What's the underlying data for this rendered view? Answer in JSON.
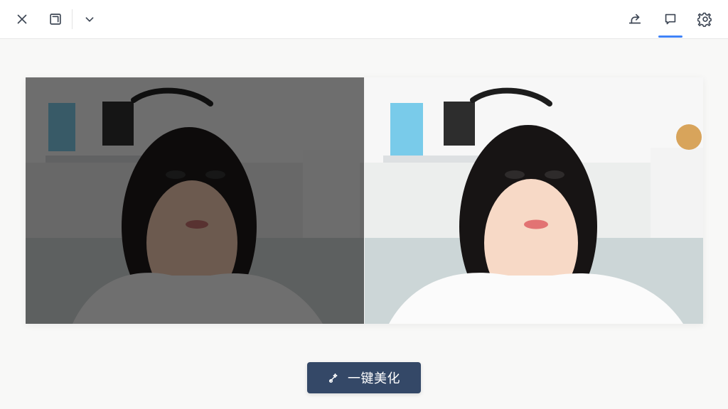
{
  "toolbar": {
    "left_icons": [
      "close-icon",
      "window-restore-icon",
      "chevron-down-icon"
    ],
    "right_icons": [
      "share-icon",
      "compare-view-icon",
      "settings-icon"
    ],
    "active_icon": "compare-view-icon",
    "accent_color": "#3f83f8"
  },
  "images": {
    "left_label": "",
    "right_label": "",
    "left_variant": "dark-original",
    "right_variant": "enhanced"
  },
  "actions": {
    "beautify_label": "一键美化",
    "button_color": "#344867"
  }
}
